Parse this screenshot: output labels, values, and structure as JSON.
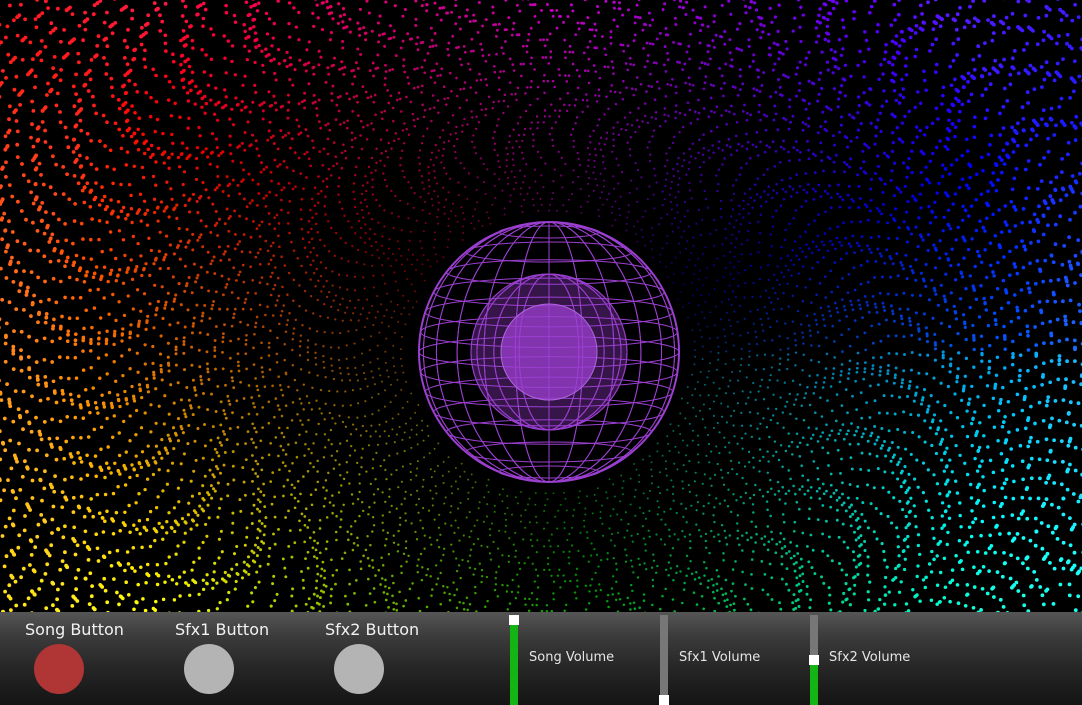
{
  "scene": {
    "background_color": "#000000",
    "orb_color": "#9b3fd0",
    "particle_palette": [
      "#00ff40",
      "#ffd000",
      "#ff2a00",
      "#00d0ff",
      "#2a2aff",
      "#ff00c8",
      "#a030ff"
    ]
  },
  "controls": {
    "buttons": [
      {
        "label": "Song Button",
        "color": "#b03535",
        "state": "active"
      },
      {
        "label": "Sfx1 Button",
        "color": "#b4b4b4",
        "state": "inactive"
      },
      {
        "label": "Sfx2 Button",
        "color": "#b4b4b4",
        "state": "inactive"
      }
    ],
    "sliders": [
      {
        "label": "Song Volume",
        "value": 1.0
      },
      {
        "label": "Sfx1 Volume",
        "value": 0.0
      },
      {
        "label": "Sfx2 Volume",
        "value": 0.5
      }
    ],
    "slider_fill_color": "#14b414",
    "slider_track_color": "#777777",
    "slider_thumb_color": "#ffffff"
  }
}
